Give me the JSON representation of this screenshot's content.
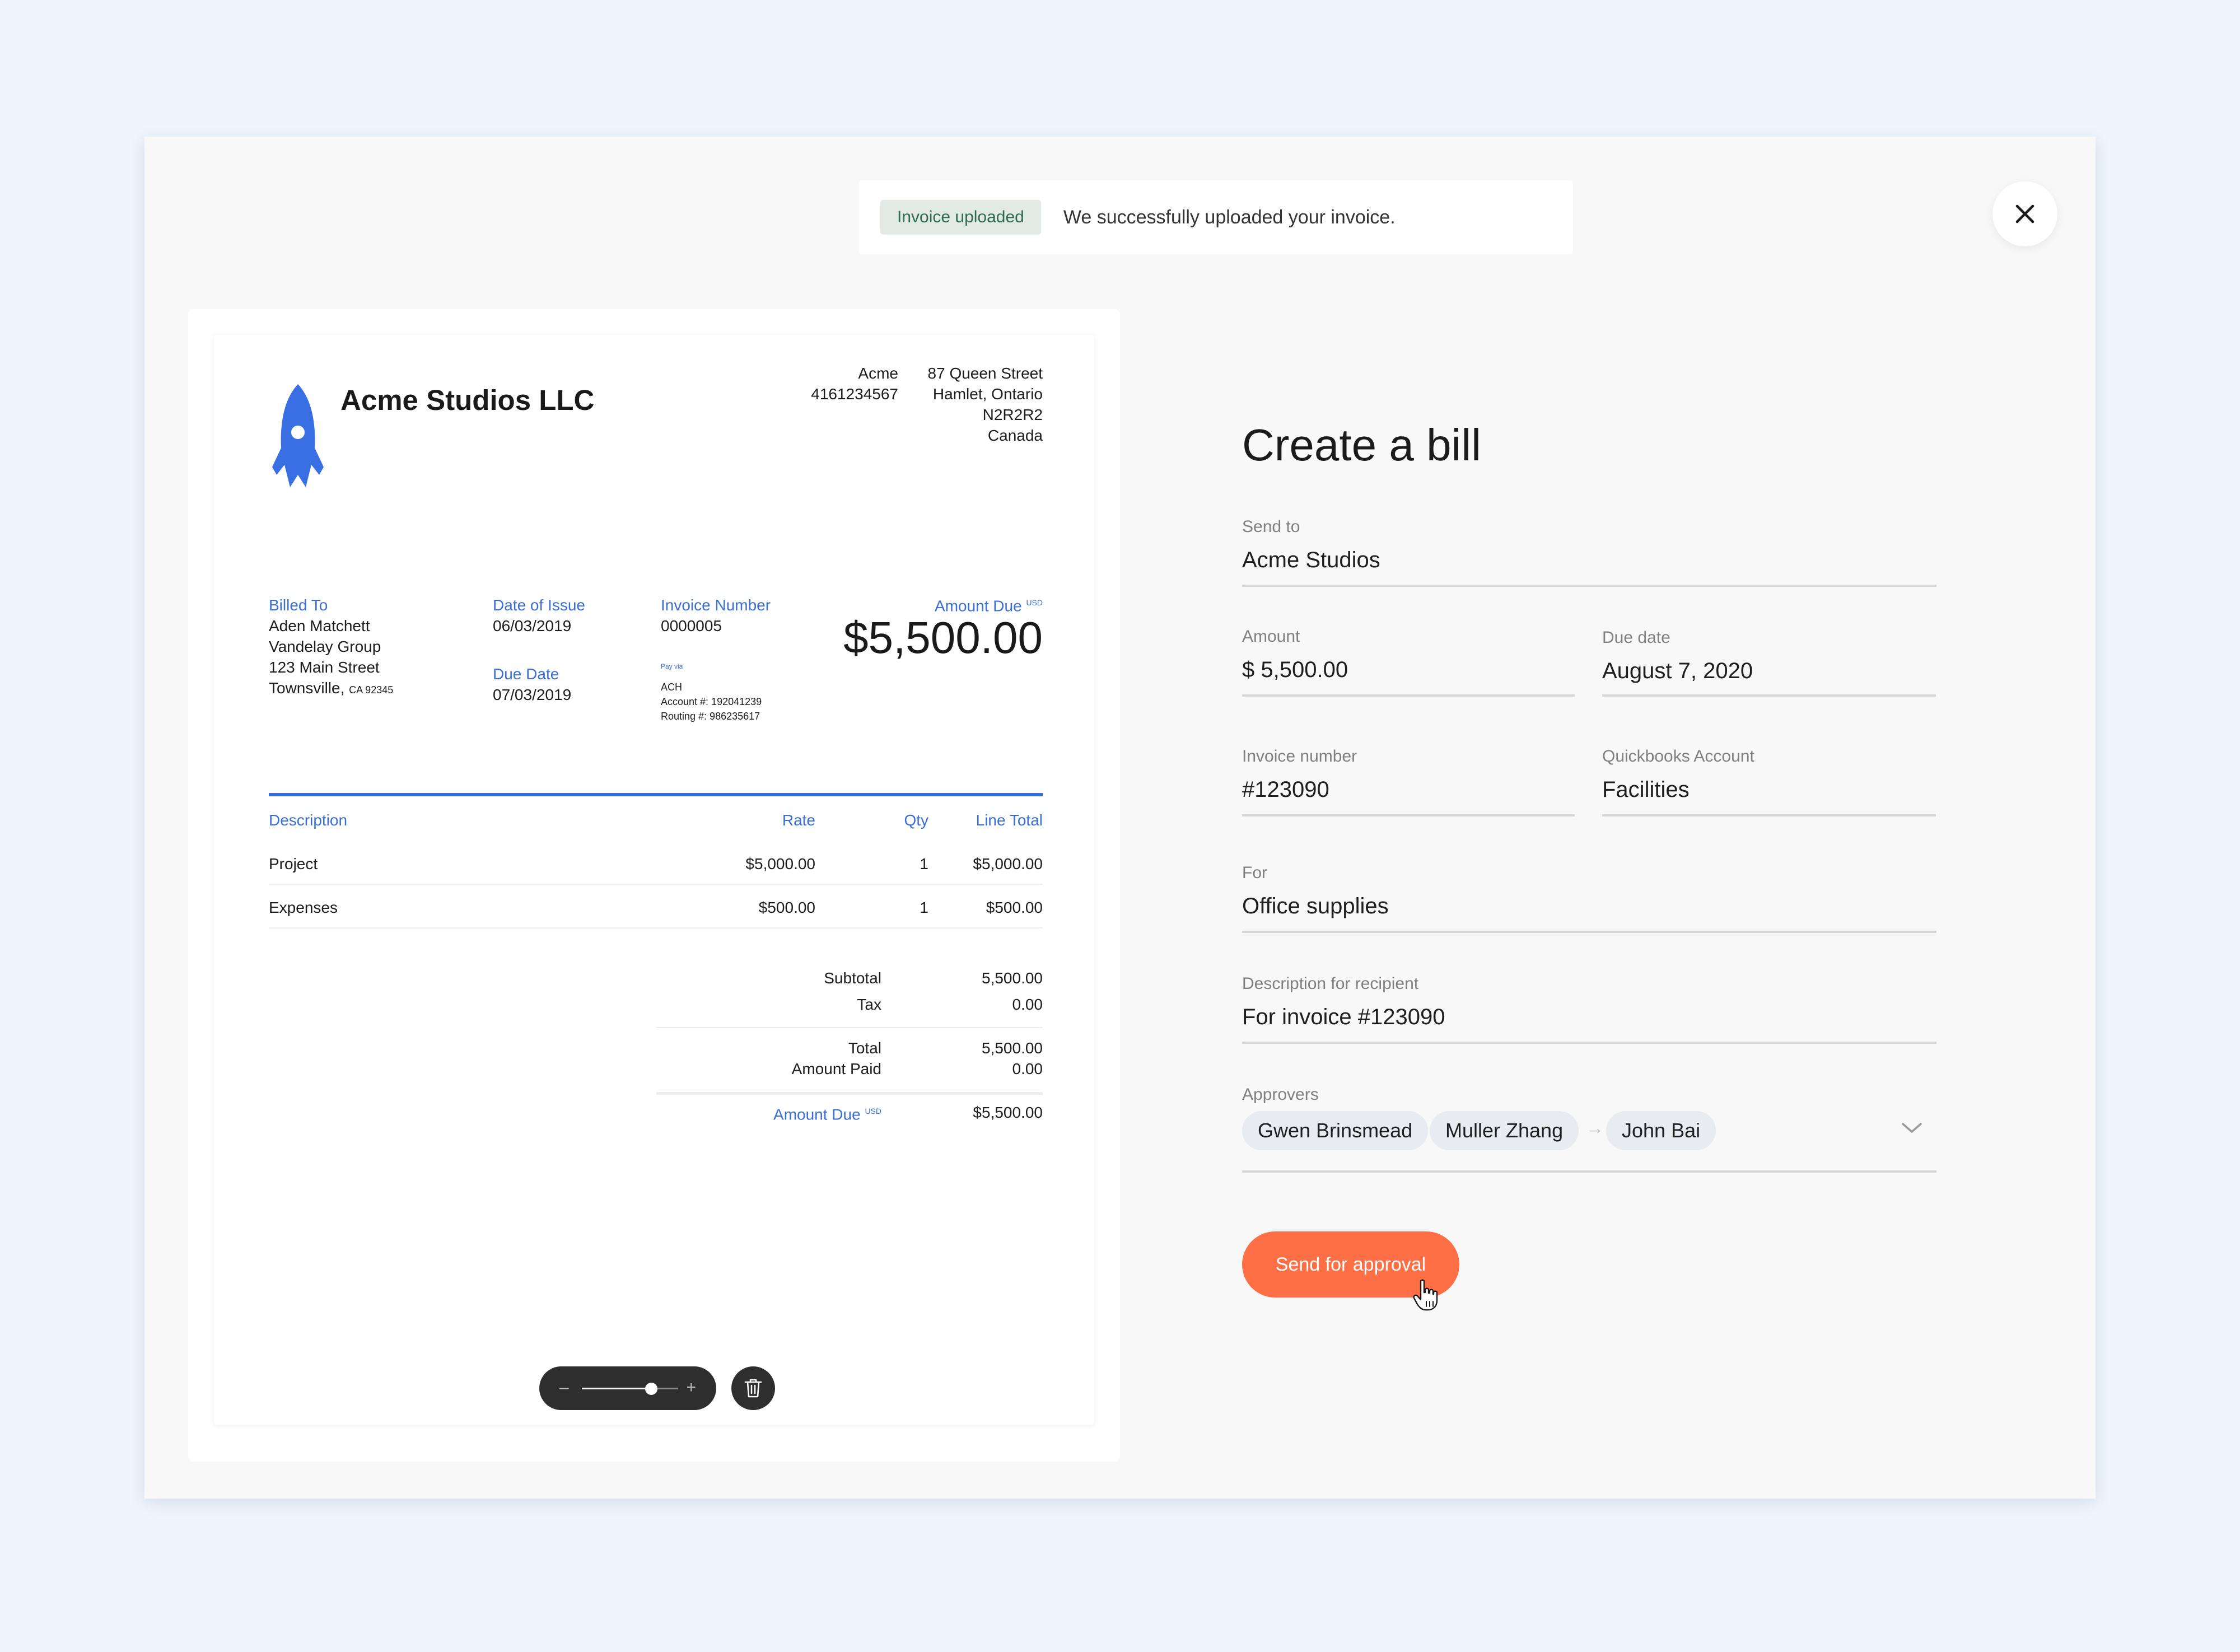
{
  "toast": {
    "badge": "Invoice uploaded",
    "message": "We successfully uploaded your invoice."
  },
  "invoice": {
    "company_name": "Acme Studios LLC",
    "sender": {
      "name": "Acme",
      "phone": "4161234567",
      "street": "87 Queen Street",
      "city": "Hamlet, Ontario",
      "postal": "N2R2R2",
      "country": "Canada"
    },
    "billed_to": {
      "label": "Billed To",
      "name": "Aden Matchett",
      "company": "Vandelay Group",
      "street": "123 Main Street",
      "city": "Townsville,",
      "state_zip": "CA 92345"
    },
    "date_of_issue": {
      "label": "Date of Issue",
      "value": "06/03/2019"
    },
    "due_date": {
      "label": "Due Date",
      "value": "07/03/2019"
    },
    "invoice_number": {
      "label": "Invoice Number",
      "value": "0000005"
    },
    "pay_via": {
      "label": "Pay via",
      "method": "ACH",
      "account": "Account #: 192041239",
      "routing": "Routing #: 986235617"
    },
    "amount_due": {
      "label": "Amount Due",
      "currency": "USD",
      "value": "$5,500.00"
    },
    "table_headers": {
      "description": "Description",
      "rate": "Rate",
      "qty": "Qty",
      "line_total": "Line Total"
    },
    "rows": [
      {
        "description": "Project",
        "rate": "$5,000.00",
        "qty": "1",
        "line_total": "$5,000.00"
      },
      {
        "description": "Expenses",
        "rate": "$500.00",
        "qty": "1",
        "line_total": "$500.00"
      }
    ],
    "totals": {
      "subtotal_label": "Subtotal",
      "subtotal": "5,500.00",
      "tax_label": "Tax",
      "tax": "0.00",
      "total_label": "Total",
      "total": "5,500.00",
      "paid_label": "Amount Paid",
      "paid": "0.00",
      "due_label": "Amount Due",
      "due_currency": "USD",
      "due": "$5,500.00"
    }
  },
  "zoom": {
    "minus": "–",
    "plus": "+",
    "level": 0.72
  },
  "form": {
    "title": "Create a bill",
    "send_to": {
      "label": "Send to",
      "value": "Acme Studios"
    },
    "amount": {
      "label": "Amount",
      "value": "$ 5,500.00"
    },
    "due_date": {
      "label": "Due date",
      "value": "August 7, 2020"
    },
    "invoice_number": {
      "label": "Invoice number",
      "value": "#123090"
    },
    "qb_account": {
      "label": "Quickbooks Account",
      "value": "Facilities"
    },
    "for": {
      "label": "For",
      "value": "Office supplies"
    },
    "description": {
      "label": "Description for recipient",
      "value": "For invoice #123090"
    },
    "approvers": {
      "label": "Approvers",
      "items": [
        "Gwen Brinsmead",
        "Muller Zhang",
        "John Bai"
      ],
      "separator": "→"
    },
    "submit_label": "Send for approval"
  },
  "colors": {
    "accent": "#ff6f45",
    "invoice_blue": "#3a6fd8",
    "badge_bg": "#e2eae6",
    "badge_text": "#2f6b52"
  }
}
